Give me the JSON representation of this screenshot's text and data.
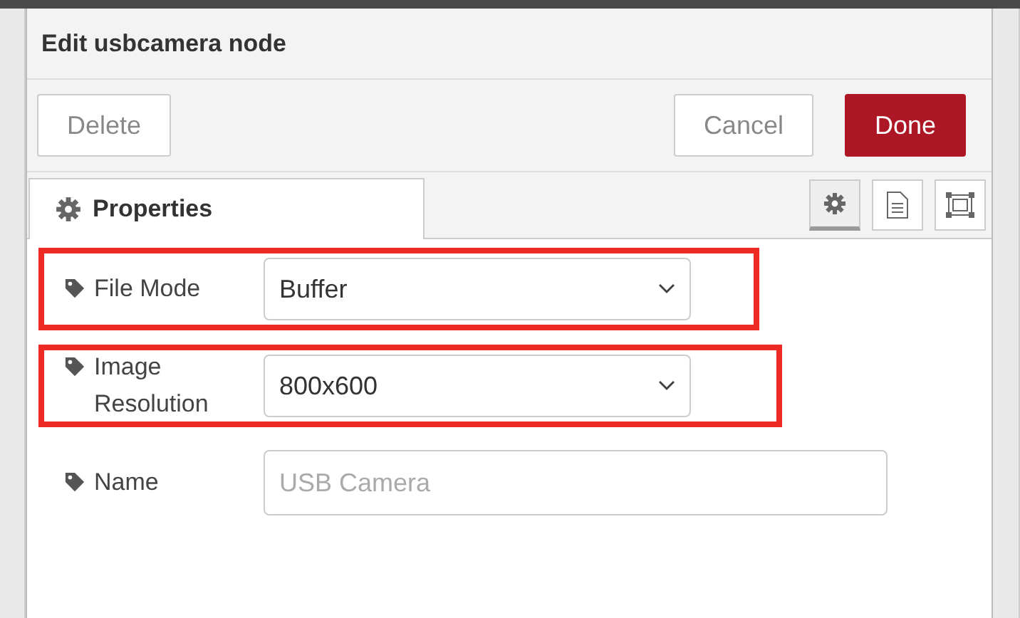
{
  "dialog": {
    "title": "Edit usbcamera node"
  },
  "buttons": [
    {
      "label": "Delete",
      "kind": "plain"
    },
    {
      "label": "Cancel",
      "kind": "plain"
    },
    {
      "label": "Done",
      "kind": "primary"
    }
  ],
  "tabs": [
    {
      "label": "Properties",
      "selected": true
    }
  ],
  "tool_tabs": [
    {
      "kind": "gear",
      "selected": true
    },
    {
      "kind": "document",
      "selected": false
    },
    {
      "kind": "frame",
      "selected": false
    }
  ],
  "fields": [
    {
      "label": "File Mode",
      "kind": "select",
      "value": "Buffer",
      "highlighted": true
    },
    {
      "label": "Image Resolution",
      "kind": "select",
      "value": "800x600",
      "highlighted": true
    },
    {
      "label": "Name",
      "kind": "text",
      "placeholder": "USB Camera",
      "highlighted": false
    }
  ]
}
